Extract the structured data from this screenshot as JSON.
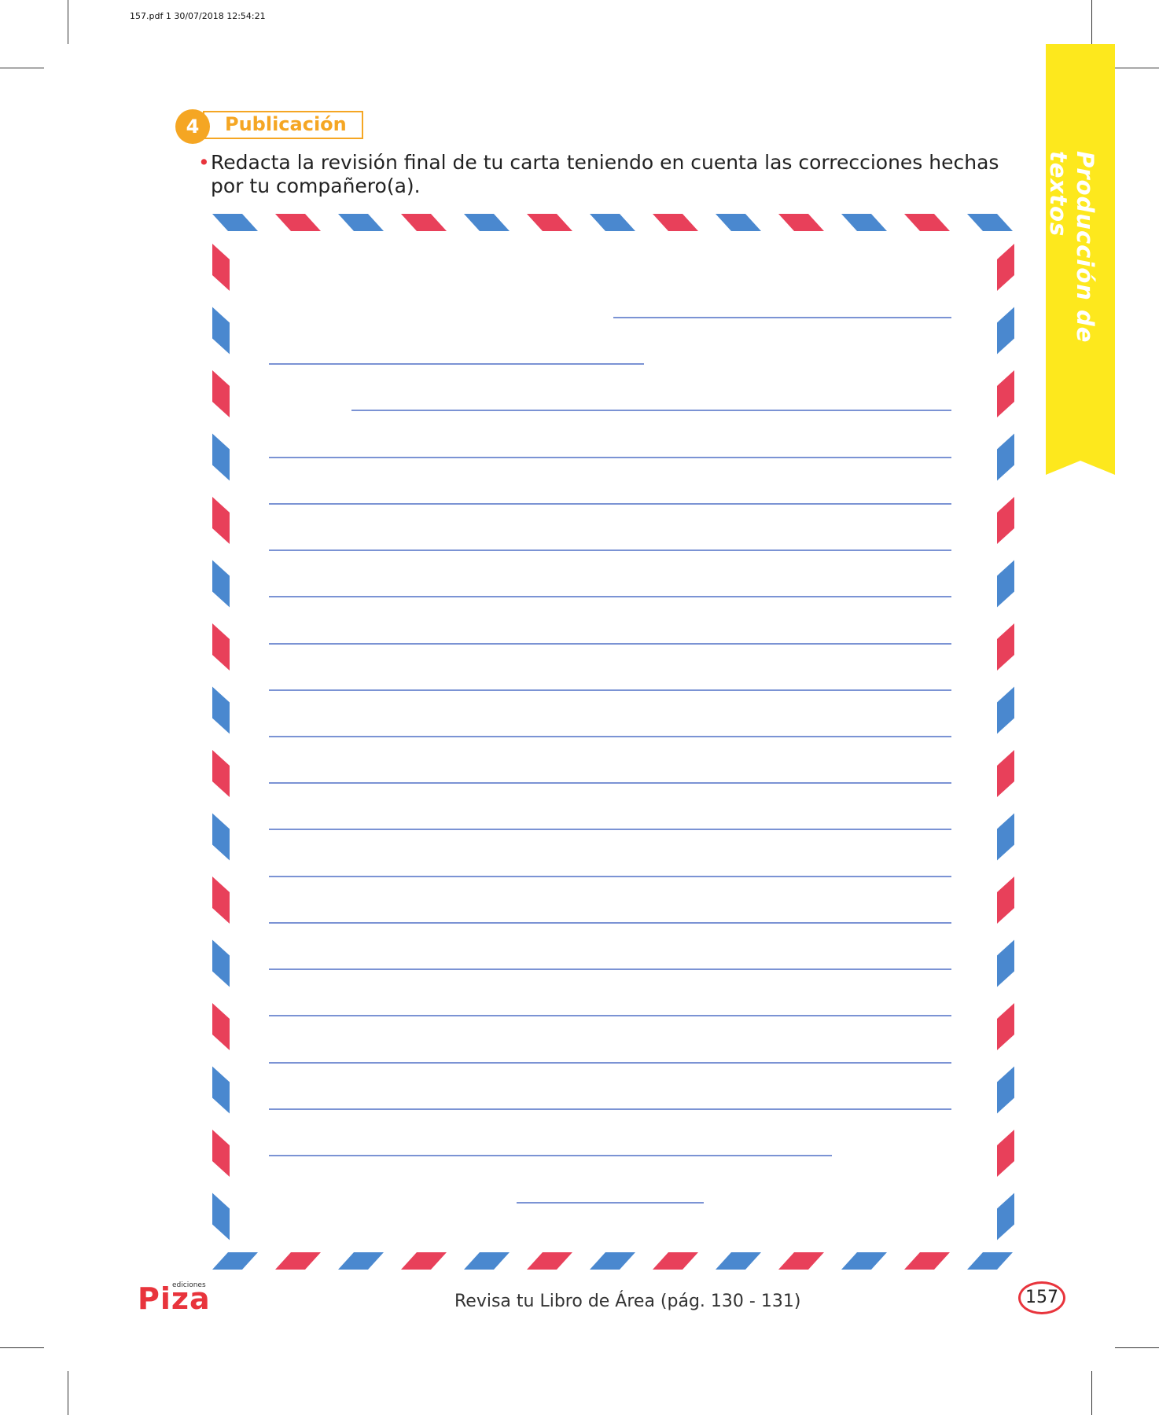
{
  "print_info": "157.pdf   1   30/07/2018   12:54:21",
  "section": {
    "number": "4",
    "title": "Publicación"
  },
  "instruction": {
    "bullet": "•",
    "text": "Redacta la revisión final de tu carta teniendo en cuenta las correcciones hechas por tu compañero(a)."
  },
  "side_tab": {
    "label": "Producción de textos"
  },
  "footer": {
    "logo": "Piza",
    "logo_subtitle": "ediciones",
    "review_note": "Revisa tu Libro de Área (pág. 130 - 131)",
    "page_number": "157"
  },
  "colors": {
    "accent_orange": "#f5a623",
    "tab_yellow": "#fde81d",
    "stripe_red": "#e8405a",
    "stripe_blue": "#4a88cf",
    "line_blue": "#7b93d4"
  }
}
